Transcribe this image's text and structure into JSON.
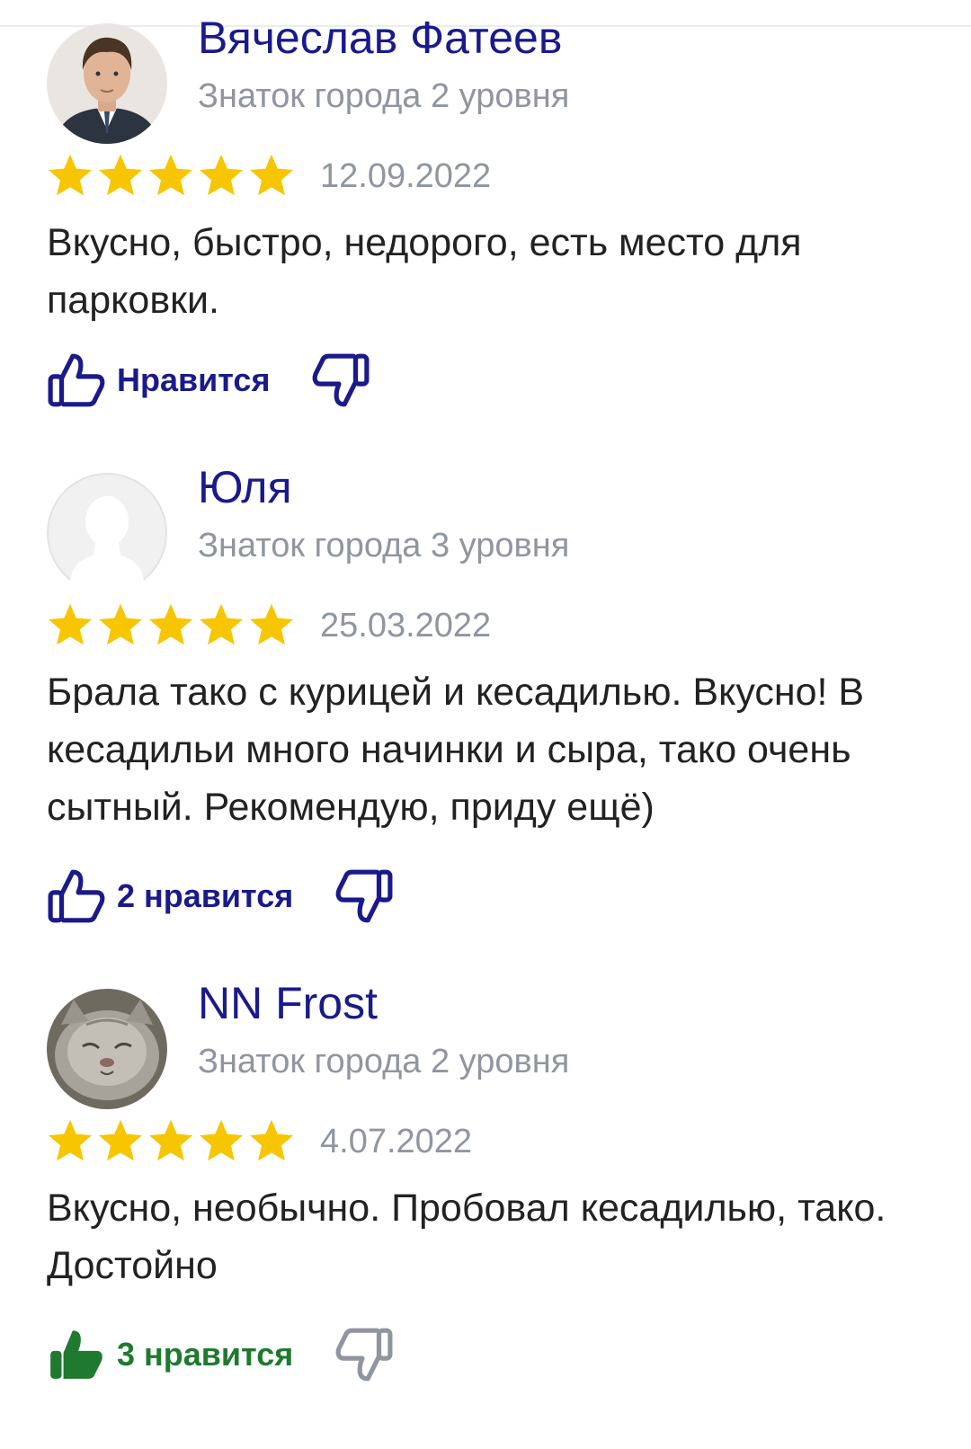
{
  "reviews": [
    {
      "author": "Вячеслав Фатеев",
      "level": "Знаток города 2 уровня",
      "rating": 5,
      "date": "12.09.2022",
      "text": "Вкусно, быстро, недорого, есть место для парковки.",
      "like_label": "Нравится",
      "liked": false,
      "avatar": "photo-man-avatar"
    },
    {
      "author": "Юля",
      "level": "Знаток города 3 уровня",
      "rating": 5,
      "date": "25.03.2022",
      "text": "Брала тако с курицей и кесадилью. Вкусно! В кесадильи много начинки и сыра, тако очень сытный. Рекомендую, приду ещё)",
      "like_label": "2 нравится",
      "liked": false,
      "avatar": "default-silhouette-avatar"
    },
    {
      "author": "NN Frost",
      "level": "Знаток города 2 уровня",
      "rating": 5,
      "date": "4.07.2022",
      "text": "Вкусно, необычно. Пробовал кесадилью, тако. Достойно",
      "like_label": "3 нравится",
      "liked": true,
      "avatar": "cat-photo-avatar"
    }
  ],
  "colors": {
    "name": "#1a1a8c",
    "meta": "#8f96a0",
    "text": "#222222",
    "star": "#f7c600",
    "like_active": "#1f7a30"
  }
}
